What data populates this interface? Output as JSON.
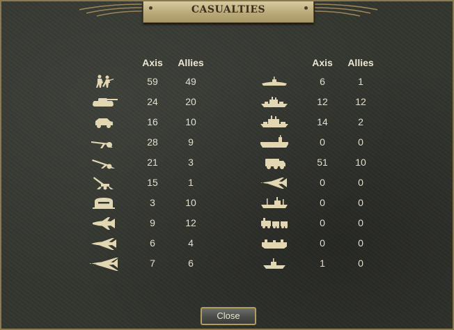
{
  "title": "CASUALTIES",
  "headers": {
    "axis": "Axis",
    "allies": "Allies"
  },
  "close_label": "Close",
  "colors": {
    "text": "#e4dfcd",
    "icon": "#e2d7b2",
    "plate": "#c8b98b",
    "border": "#b09d5f"
  },
  "left_rows": [
    {
      "icon": "infantry-icon",
      "axis": "59",
      "allies": "49"
    },
    {
      "icon": "tank-icon",
      "axis": "24",
      "allies": "20"
    },
    {
      "icon": "armored-car-icon",
      "axis": "16",
      "allies": "10"
    },
    {
      "icon": "field-artillery-icon",
      "axis": "28",
      "allies": "9"
    },
    {
      "icon": "anti-tank-gun-icon",
      "axis": "21",
      "allies": "3"
    },
    {
      "icon": "anti-air-gun-icon",
      "axis": "15",
      "allies": "1"
    },
    {
      "icon": "bunker-icon",
      "axis": "3",
      "allies": "10"
    },
    {
      "icon": "fighter-plane-icon",
      "axis": "9",
      "allies": "12"
    },
    {
      "icon": "tactical-bomber-icon",
      "axis": "6",
      "allies": "4"
    },
    {
      "icon": "strategic-bomber-icon",
      "axis": "7",
      "allies": "6"
    }
  ],
  "right_rows": [
    {
      "icon": "submarine-icon",
      "axis": "6",
      "allies": "1"
    },
    {
      "icon": "destroyer-icon",
      "axis": "12",
      "allies": "12"
    },
    {
      "icon": "cruiser-icon",
      "axis": "14",
      "allies": "2"
    },
    {
      "icon": "aircraft-carrier-icon",
      "axis": "0",
      "allies": "0"
    },
    {
      "icon": "supply-truck-icon",
      "axis": "51",
      "allies": "10"
    },
    {
      "icon": "transport-plane-icon",
      "axis": "0",
      "allies": "0"
    },
    {
      "icon": "transport-ship-icon",
      "axis": "0",
      "allies": "0"
    },
    {
      "icon": "armored-train-icon",
      "axis": "0",
      "allies": "0"
    },
    {
      "icon": "landing-craft-icon",
      "axis": "0",
      "allies": "0"
    },
    {
      "icon": "patrol-boat-icon",
      "axis": "1",
      "allies": "0"
    }
  ]
}
